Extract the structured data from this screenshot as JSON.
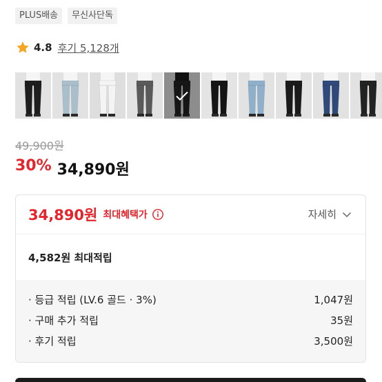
{
  "badges": [
    "PLUS배송",
    "무신사단독"
  ],
  "rating": {
    "score": "4.8",
    "reviews_label": "후기 5,128개"
  },
  "thumbnails": [
    {
      "name": "jeans-black",
      "color": "#1e1e1e",
      "bg": "#e2e2e2",
      "selected": false
    },
    {
      "name": "jeans-lightblue",
      "color": "#a9bfcc",
      "bg": "#e2e2e2",
      "selected": false
    },
    {
      "name": "jeans-white",
      "color": "#f4f4f4",
      "bg": "#dedede",
      "selected": false
    },
    {
      "name": "jeans-grey",
      "color": "#5a5a5a",
      "bg": "#e2e2e2",
      "selected": false
    },
    {
      "name": "jeans-selected",
      "color": "#222222",
      "bg": "#d9d9d9",
      "selected": true
    },
    {
      "name": "jeans-black-2",
      "color": "#151515",
      "bg": "#e4e4e4",
      "selected": false
    },
    {
      "name": "jeans-lightwash",
      "color": "#8fb0cb",
      "bg": "#e2e2e2",
      "selected": false
    },
    {
      "name": "jeans-darkblack",
      "color": "#1a1a1a",
      "bg": "#e2e2e2",
      "selected": false
    },
    {
      "name": "jeans-indigo",
      "color": "#2f4a7a",
      "bg": "#e2e2e2",
      "selected": false
    },
    {
      "name": "jeans-partial",
      "color": "#222222",
      "bg": "#e2e2e2",
      "selected": false
    }
  ],
  "price": {
    "original": "49,900원",
    "discount": "30%",
    "sale": "34,890원"
  },
  "benefit_card": {
    "best_price": "34,890원",
    "best_label": "최대혜택가",
    "detail_label": "자세히",
    "points_total": "4,582원 최대적립",
    "rows": [
      {
        "label": "· 등급 적립 (LV.6 골드 · 3%)",
        "value": "1,047원"
      },
      {
        "label": "· 구매 추가 적립",
        "value": "35원"
      },
      {
        "label": "· 후기 적립",
        "value": "3,500원"
      }
    ]
  },
  "colors": {
    "accent_red": "#e4252c",
    "star": "#f5a623"
  }
}
